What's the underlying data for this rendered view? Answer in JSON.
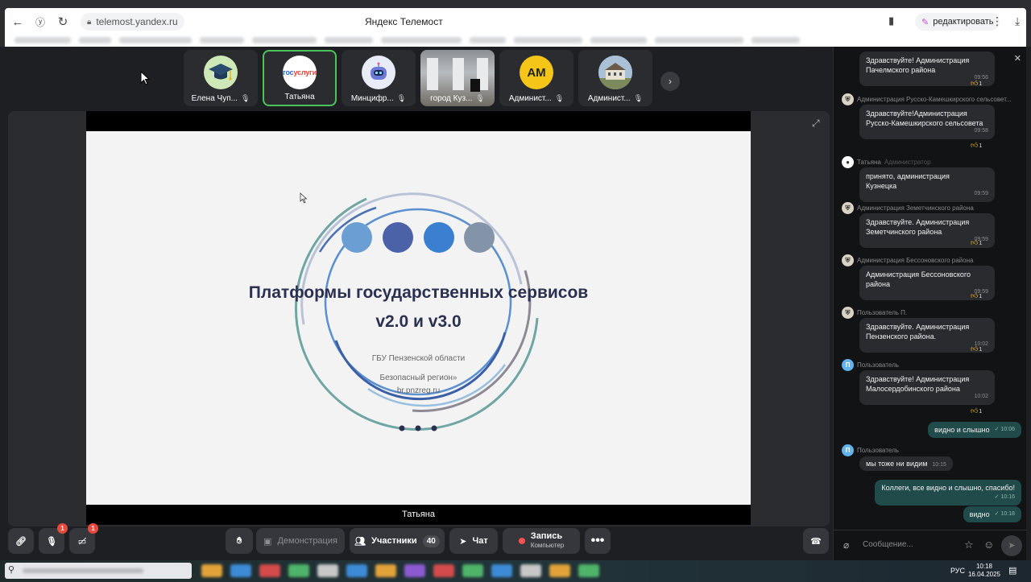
{
  "browser": {
    "url": "telemost.yandex.ru",
    "page_title": "Яндекс Телемост",
    "edit_label": "редактировать"
  },
  "participants": [
    {
      "name": "Елена Чуп...",
      "avatar": "graduation-cap-icon",
      "muted": true
    },
    {
      "name": "Татьяна",
      "avatar": "gosuslugi-logo",
      "muted": false,
      "active": true
    },
    {
      "name": "Минцифр...",
      "avatar": "robot-icon",
      "muted": true
    },
    {
      "name": "город Куз...",
      "avatar": "camera-photo",
      "muted": true
    },
    {
      "name": "Админист...",
      "avatar_text": "АМ",
      "avatar_color": "#f5c518",
      "muted": true
    },
    {
      "name": "Админист...",
      "avatar": "building-photo",
      "muted": true
    }
  ],
  "gosuslugi_logo": {
    "part1": "гос",
    "part2": "услуги"
  },
  "slide": {
    "title": "Платформы государственных сервисов",
    "subtitle": "v2.0 и v3.0",
    "org_line1": "ГБУ Пензенской области",
    "org_line2": "Безопасный регион»",
    "org_line3": "br.pnzreg.ru",
    "dot_colors": [
      "#6b9fd4",
      "#4b62a8",
      "#3a7fd0",
      "#8494a8"
    ]
  },
  "video_label": "Татьяна",
  "toolbar": {
    "mic_badge": "1",
    "camera_badge": "1",
    "demo_label": "Демонстрация",
    "participants_label": "Участники",
    "participants_count": "40",
    "chat_label": "Чат",
    "record_label": "Запись",
    "record_sub": "Компьютер"
  },
  "chat": {
    "messages": [
      {
        "text1": "Здравствуйте! Администрация",
        "text2": "Пачелмского района",
        "time": "09:56",
        "reactions": "1"
      },
      {
        "author": "Администрация Русско-Камешкирского сельсовет...",
        "avatar": "emblem",
        "text1": "Здравствуйте!Администрация",
        "text2": "Русско-Камешкирского сельсовета",
        "time": "09:58",
        "reactions": "1"
      },
      {
        "author": "Татьяна",
        "role": "Администратор",
        "avatar": "gosuslugi",
        "text1": "принято,  администрация",
        "text2": "Кузнецка",
        "time": "09:59"
      },
      {
        "author": "Администрация Земетчинского района",
        "avatar": "emblem",
        "text1": "Здравствуйте. Администрация",
        "text2": "Земетчинского района",
        "time": "09:59",
        "reactions": "1"
      },
      {
        "author": "Администрация Бессоновского района",
        "avatar": "emblem",
        "text1": "Администрация Бессоновского",
        "text2": "района",
        "time": "09:59",
        "reactions": "1"
      },
      {
        "author": "Пользователь П.",
        "avatar": "emblem",
        "text1": "Здравствуйте. Администрация",
        "text2": "Пензенского района.",
        "time": "10:02",
        "reactions": "1"
      },
      {
        "author": "Пользователь",
        "avatar_letter": "П",
        "text1": "Здравствуйте! Администрация",
        "text2": "Малосердобинского района",
        "time": "10:02",
        "reactions": "1"
      }
    ],
    "own1": {
      "text": "видно и слышно",
      "time": "10:06"
    },
    "incoming": {
      "author": "Пользователь",
      "avatar_letter": "П",
      "text": "мы тоже ни видим",
      "time": "10:15"
    },
    "own2": {
      "text": "Коллеги, все видно и слышно, спасибо!",
      "time": "10:16"
    },
    "own3": {
      "text": "видно",
      "time": "10:18"
    },
    "placeholder": "Сообщение..."
  },
  "taskbar": {
    "lang": "РУС",
    "time": "10:18",
    "date": "16.04.2025"
  }
}
